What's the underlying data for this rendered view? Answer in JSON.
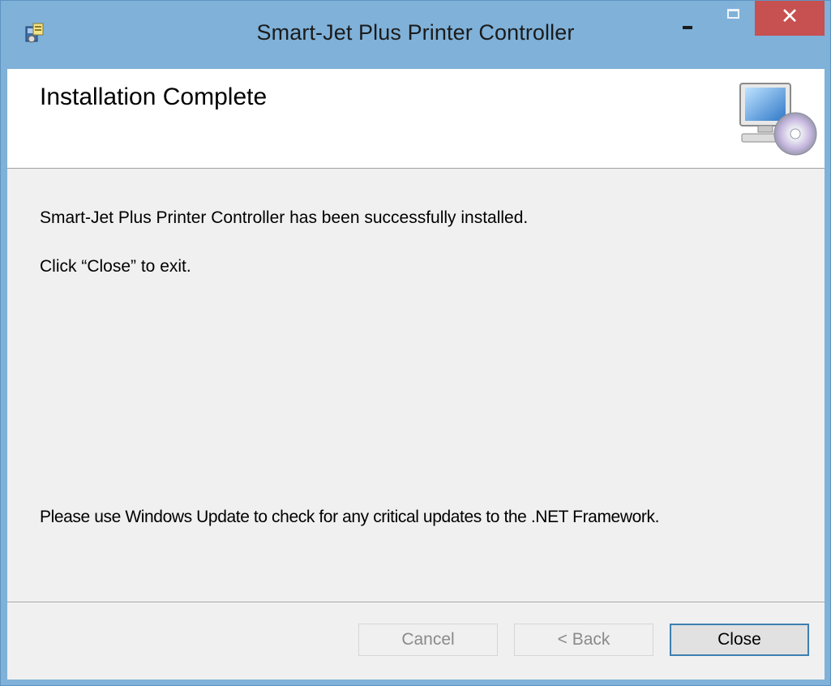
{
  "window": {
    "title": "Smart-Jet Plus Printer Controller",
    "caption_buttons": {
      "minimize_icon": "minimize-icon",
      "maximize_icon": "maximize-icon",
      "close_glyph": "✕"
    },
    "app_icon": "installer-icon"
  },
  "banner": {
    "title": "Installation Complete",
    "icon": "computer-cd-icon"
  },
  "content": {
    "success_message": "Smart-Jet Plus Printer Controller has been successfully installed.",
    "instruction": "Click “Close” to exit.",
    "update_note": "Please use Windows Update to check for any critical updates to the .NET Framework."
  },
  "buttons": {
    "cancel": "Cancel",
    "back": "< Back",
    "close": "Close"
  },
  "colors": {
    "titlebar": "#7fb1d9",
    "close_button": "#c75050",
    "dialog_background": "#f0f0f0",
    "default_button_border": "#3c7fb1"
  }
}
